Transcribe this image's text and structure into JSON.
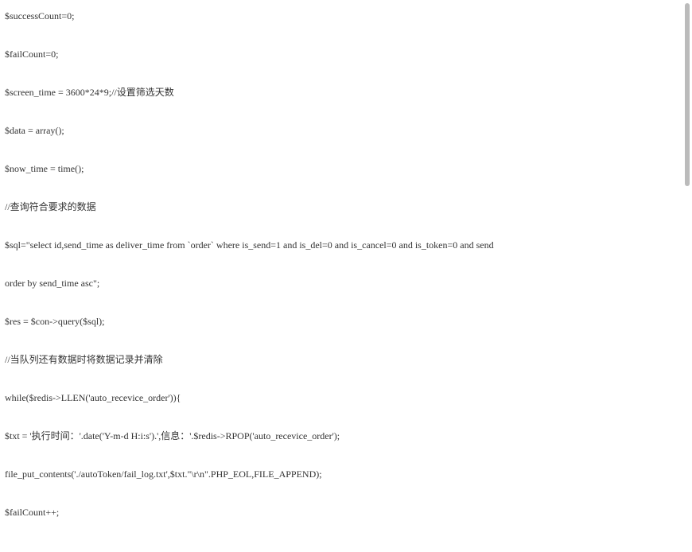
{
  "code": {
    "lines": [
      "$successCount=0;",
      "$failCount=0;",
      "$screen_time = 3600*24*9;//设置筛选天数",
      "$data = array();",
      "$now_time = time();",
      "//查询符合要求的数据",
      "$sql=\"select id,send_time as deliver_time from `order` where is_send=1 and is_del=0 and is_cancel=0 and is_token=0 and send",
      "order by send_time asc\";",
      "$res = $con->query($sql);",
      "//当队列还有数据时将数据记录并清除",
      "while($redis->LLEN('auto_recevice_order')){",
      "$txt = '执行时间：'.date('Y-m-d H:i:s').',信息：'.$redis->RPOP('auto_recevice_order');",
      "file_put_contents('./autoToken/fail_log.txt',$txt.\"\\r\\n\".PHP_EOL,FILE_APPEND);",
      "$failCount++;",
      "}"
    ]
  }
}
